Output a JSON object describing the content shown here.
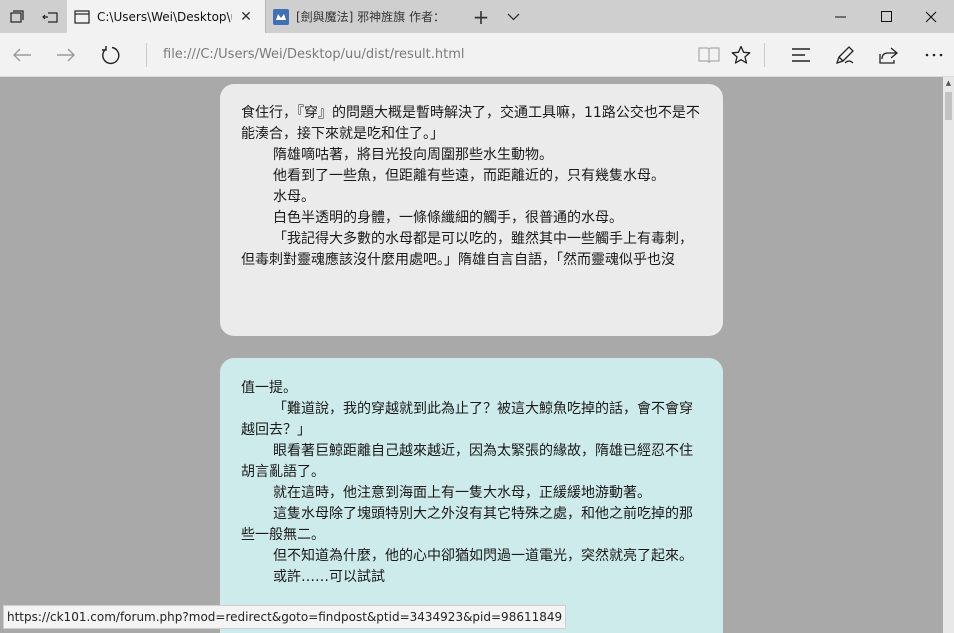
{
  "tabs": [
    {
      "title": "C:\\Users\\Wei\\Desktop\\u",
      "active": true
    },
    {
      "title": "[劍與魔法] 邪神旌旗 作者：",
      "active": false
    }
  ],
  "address": {
    "url": "file:///C:/Users/Wei/Desktop/uu/dist/result.html"
  },
  "card1": {
    "lines": [
      "食住行，『穿』的問題大概是暫時解決了，交通工具嘛，11路公交也不是不能湊合，接下來就是吃和住了。」",
      "隋雄嘀咕著，將目光投向周圍那些水生動物。",
      "他看到了一些魚，但距離有些遠，而距離近的，只有幾隻水母。",
      "水母。",
      "白色半透明的身體，一條條纖細的觸手，很普通的水母。",
      "「我記得大多數的水母都是可以吃的，雖然其中一些觸手上有毒刺，但毒刺對靈魂應該沒什麼用處吧。」隋雄自言自語，「然而靈魂似乎也沒"
    ]
  },
  "card2": {
    "lines": [
      "值一提。",
      "「難道說，我的穿越就到此為止了？被這大鯨魚吃掉的話，會不會穿越回去？」",
      "眼看著巨鯨距離自己越來越近，因為太緊張的緣故，隋雄已經忍不住胡言亂語了。",
      "就在這時，他注意到海面上有一隻大水母，正緩緩地游動著。",
      "這隻水母除了塊頭特別大之外沒有其它特殊之處，和他之前吃掉的那些一般無二。",
      "但不知道為什麼，他的心中卻猶如閃過一道電光，突然就亮了起來。",
      "或許……可以試試"
    ]
  },
  "status_url": "https://ck101.com/forum.php?mod=redirect&goto=findpost&ptid=3434923&pid=98611849",
  "colors": {
    "card_gray": "#ebebeb",
    "card_cyan": "#cdebea",
    "page_bg": "#a9a9a9"
  }
}
